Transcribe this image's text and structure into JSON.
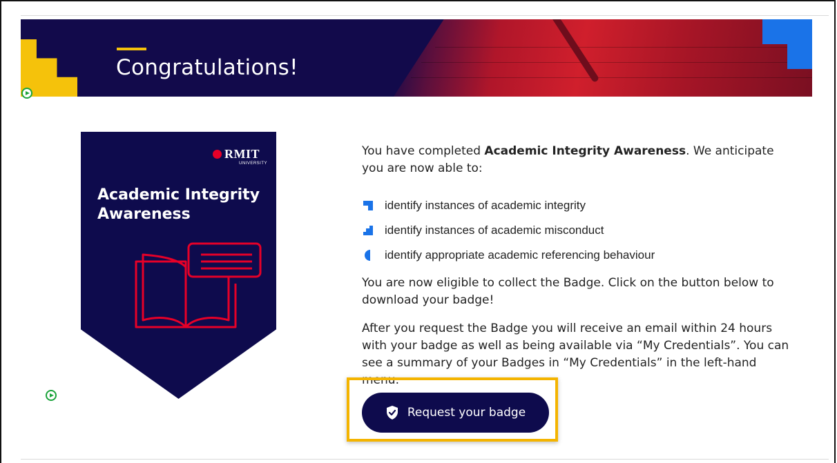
{
  "banner": {
    "title": "Congratulations!"
  },
  "badge": {
    "logo_text": "RMIT",
    "logo_subtext": "UNIVERSITY",
    "title": "Academic Integrity Awareness",
    "icon": "open-book-with-speech-bubble-icon"
  },
  "content": {
    "intro_prefix": "You have completed ",
    "intro_bold": "Academic Integrity Awareness",
    "intro_suffix": ". We anticipate you are now able to:",
    "outcomes": [
      {
        "icon": "blue-corner-icon",
        "text": "identify instances of academic integrity"
      },
      {
        "icon": "blue-steps-icon",
        "text": "identify instances of academic misconduct"
      },
      {
        "icon": "blue-half-circle-icon",
        "text": "identify appropriate academic referencing behaviour"
      }
    ],
    "eligible_text": "You are now eligible to collect the Badge. Click on the button below to download your badge!",
    "after_text": "After you request the Badge you will receive an email within 24 hours with your badge as well as being available via “My Credentials”. You can see a summary of your Badges in “My Credentials” in the left-hand menu."
  },
  "button": {
    "label": "Request your badge",
    "icon": "shield-check-icon"
  },
  "colors": {
    "navy": "#0e0b4d",
    "rmit_red": "#e60028",
    "yellow": "#f5c20b",
    "blue": "#1a73e8",
    "highlight": "#f4b400"
  }
}
